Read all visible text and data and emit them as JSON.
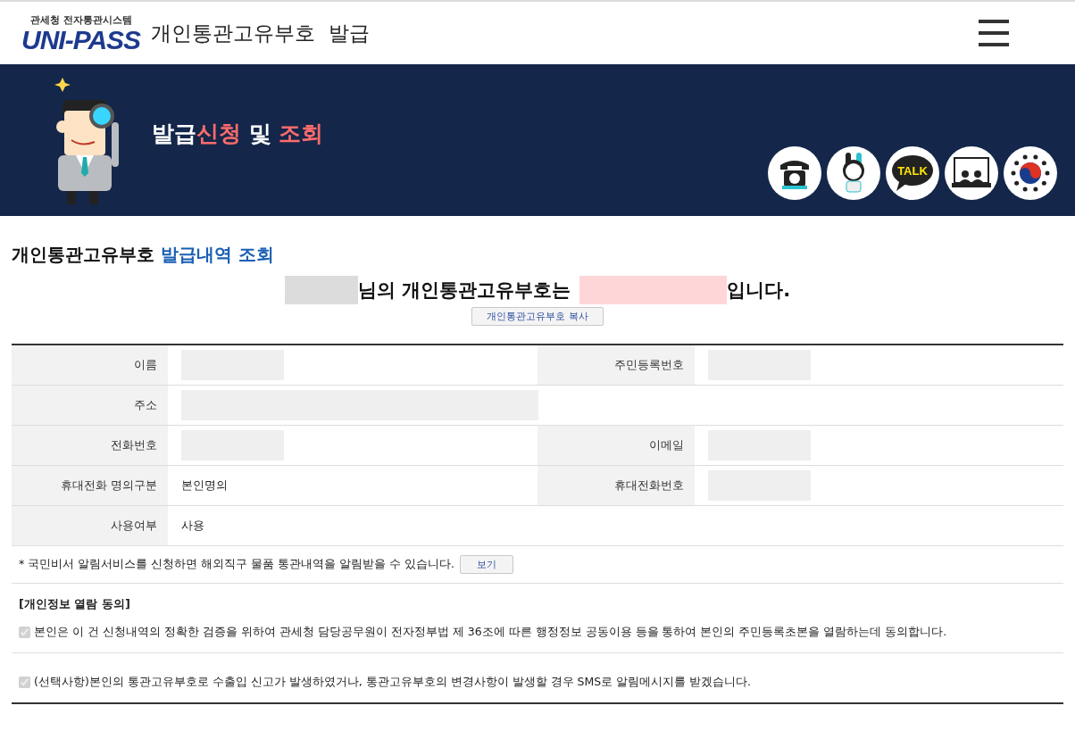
{
  "header": {
    "logo_caption": "관세청 전자통관시스템",
    "logo_text": "UNI-PASS",
    "title": "개인통관고유부호  발급"
  },
  "banner": {
    "title_parts": [
      {
        "text": "발급",
        "accent": false
      },
      {
        "text": "신청",
        "accent": true
      },
      {
        "text": " 및 ",
        "accent": false
      },
      {
        "text": "조회",
        "accent": true
      }
    ],
    "quick_links": [
      {
        "kind": "phone"
      },
      {
        "kind": "mascot"
      },
      {
        "kind": "talk",
        "label": "TALK"
      },
      {
        "kind": "video"
      },
      {
        "kind": "emblem"
      }
    ]
  },
  "section": {
    "title": "개인통관고유부호",
    "title_accent": "발급내역 조회"
  },
  "result": {
    "name_redacted": true,
    "before": "님의 개인통관고유부호는",
    "code_redacted": true,
    "after": "입니다.",
    "copy_button": "개인통관고유부호 복사"
  },
  "table": {
    "rows": [
      [
        {
          "label": "이름",
          "redacted": true
        },
        {
          "label": "주민등록번호",
          "redacted": true
        }
      ],
      [
        {
          "label": "주소",
          "redacted": true
        }
      ],
      [
        {
          "label": "전화번호",
          "redacted": true
        },
        {
          "label": "이메일",
          "redacted": true
        }
      ],
      [
        {
          "label": "휴대전화 명의구분",
          "value": "본인명의"
        },
        {
          "label": "휴대전화번호",
          "redacted": true
        }
      ],
      [
        {
          "label": "사용여부",
          "value": "사용"
        }
      ]
    ]
  },
  "notice": {
    "text": "* 국민비서 알림서비스를 신청하면 해외직구 물품 통관내역을 알림받을 수 있습니다.",
    "button": "보기"
  },
  "consent": {
    "title": "[개인정보 열람 동의]",
    "items": [
      {
        "text": "본인은 이 건 신청내역의 정확한 검증을 위하여 관세청 담당공무원이 전자정부법 제 36조에 따른 행정정보 공동이용 등을 통하여 본인의 주민등록초본을 열람하는데 동의합니다.",
        "checked": true,
        "disabled": true
      },
      {
        "text": "(선택사항)본인의 통관고유부호로 수출입 신고가 발생하였거나, 통관고유부호의 변경사항이 발생할 경우 SMS로 알림메시지를 받겠습니다.",
        "checked": true,
        "disabled": true
      }
    ]
  }
}
